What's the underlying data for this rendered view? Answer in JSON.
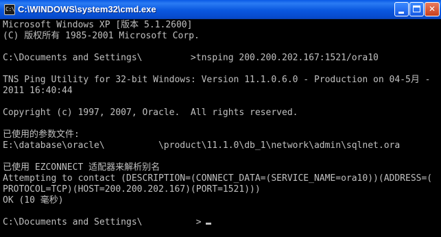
{
  "window": {
    "icon_label": "C:\\",
    "title": "C:\\WINDOWS\\system32\\cmd.exe",
    "minimize_glyph": "",
    "maximize_glyph": "",
    "close_glyph": "✕"
  },
  "console": {
    "lines": [
      "Microsoft Windows XP [版本 5.1.2600]",
      "(C) 版权所有 1985-2001 Microsoft Corp.",
      "",
      "C:\\Documents and Settings\\         >tnsping 200.200.202.167:1521/ora10",
      "",
      "TNS Ping Utility for 32-bit Windows: Version 11.1.0.6.0 - Production on 04-5月 -",
      "2011 16:40:44",
      "",
      "Copyright (c) 1997, 2007, Oracle.  All rights reserved.",
      "",
      "已使用的参数文件:",
      "E:\\database\\oracle\\          \\product\\11.1.0\\db_1\\network\\admin\\sqlnet.ora",
      "",
      "已使用 EZCONNECT 适配器来解析别名",
      "Attempting to contact (DESCRIPTION=(CONNECT_DATA=(SERVICE_NAME=ora10))(ADDRESS=(",
      "PROTOCOL=TCP)(HOST=200.200.202.167)(PORT=1521)))",
      "OK (10 毫秒)",
      "",
      "C:\\Documents and Settings\\          >"
    ]
  },
  "colors": {
    "title_bar": "#0a58e0",
    "console_bg": "#000000",
    "console_fg": "#c0c0c0",
    "close_button": "#c8401e"
  }
}
